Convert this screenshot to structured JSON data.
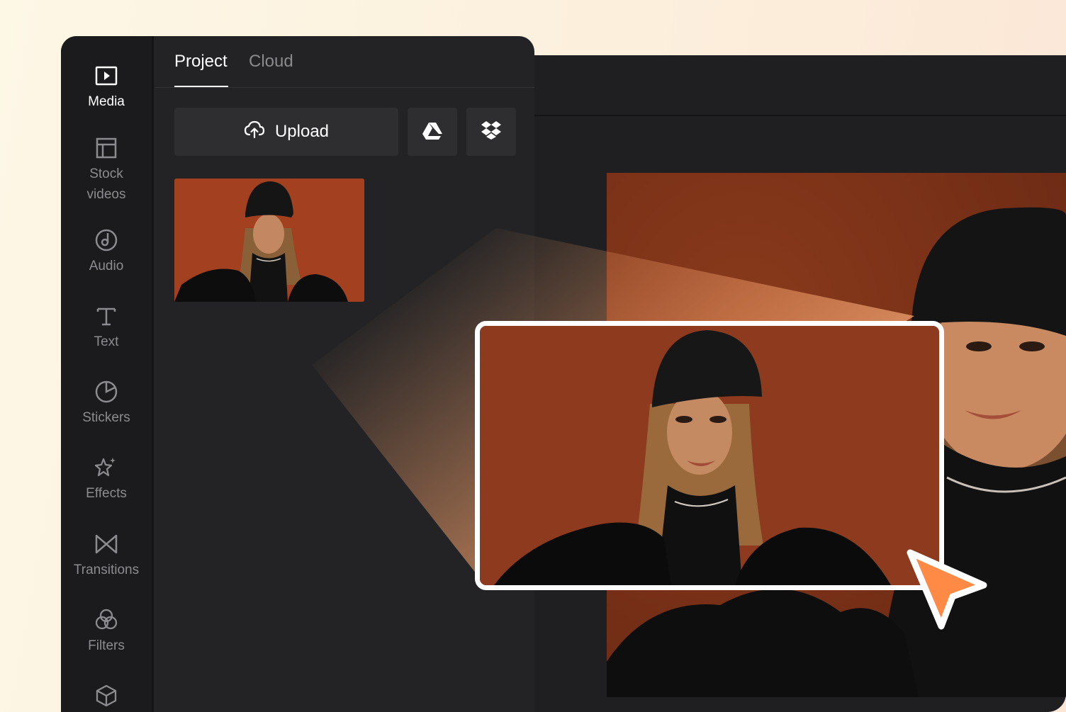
{
  "sidebar": {
    "items": [
      {
        "label": "Media",
        "icon": "play-media-icon",
        "active": true
      },
      {
        "label": "Stock\nvideos",
        "icon": "layout-grid-icon",
        "active": false
      },
      {
        "label": "Audio",
        "icon": "music-note-icon",
        "active": false
      },
      {
        "label": "Text",
        "icon": "text-t-icon",
        "active": false
      },
      {
        "label": "Stickers",
        "icon": "sticker-icon",
        "active": false
      },
      {
        "label": "Effects",
        "icon": "sparkle-star-icon",
        "active": false
      },
      {
        "label": "Transitions",
        "icon": "bowtie-transition-icon",
        "active": false
      },
      {
        "label": "Filters",
        "icon": "filters-circles-icon",
        "active": false
      },
      {
        "label": "",
        "icon": "cube-icon",
        "active": false
      }
    ]
  },
  "tabs": [
    {
      "label": "Project",
      "active": true
    },
    {
      "label": "Cloud",
      "active": false
    }
  ],
  "upload": {
    "label": "Upload"
  },
  "colors": {
    "accent": "#ff8a45",
    "panel": "#232325",
    "sidebar": "#1b1b1d",
    "background_orange": "#8b3a1e"
  }
}
